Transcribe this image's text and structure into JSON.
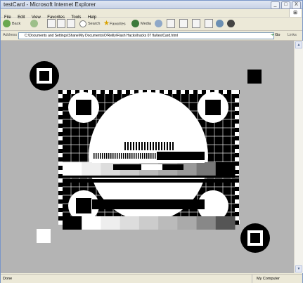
{
  "window": {
    "title": "testCard - Microsoft Internet Explorer",
    "controls": [
      "_",
      "□",
      "X"
    ]
  },
  "menu": [
    "File",
    "Edit",
    "View",
    "Favorites",
    "Tools",
    "Help"
  ],
  "toolbar": {
    "back": "Back",
    "search": "Search",
    "favorites": "Favorites",
    "media": "Media"
  },
  "address": {
    "label": "Address",
    "url": "C:\\Documents and Settings\\Shane\\My Documents\\O'Reilly\\Flash Hacks\\hacks 07 fla\\testCard.html",
    "go": "Go",
    "links": "Links"
  },
  "status": {
    "left": "Done",
    "right": "My Computer"
  },
  "test_card": {
    "background": "#b4b4b4",
    "greyscale": [
      "#ffffff",
      "#eeeeee",
      "#dddddd",
      "#cccccc",
      "#bbbbbb",
      "#aaaaaa",
      "#999999",
      "#777777",
      "#000000"
    ],
    "greyscale_lower": [
      "#000000",
      "#ffffff",
      "#eeeeee",
      "#dddddd",
      "#cccccc",
      "#bbbbbb",
      "#aaaaaa",
      "#888888",
      "#555555"
    ]
  },
  "colors": {
    "chrome": "#ece9d8",
    "border": "#7a96c8",
    "page_grey": "#b4b4b4"
  }
}
